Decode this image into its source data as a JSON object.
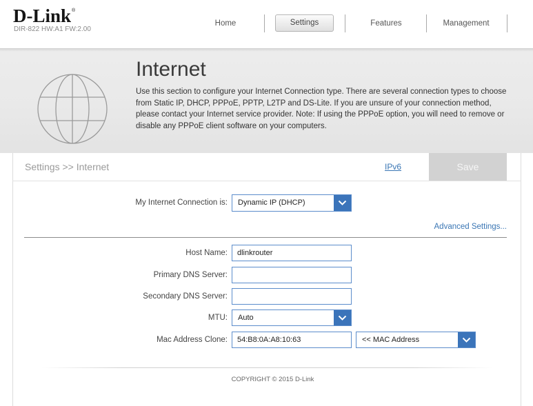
{
  "header": {
    "logo_text": "D-Link",
    "logo_mark": "®",
    "model_info": "DIR-822 HW:A1 FW:2.00",
    "nav": [
      {
        "label": "Home",
        "active": false
      },
      {
        "label": "Settings",
        "active": true
      },
      {
        "label": "Features",
        "active": false
      },
      {
        "label": "Management",
        "active": false
      }
    ]
  },
  "banner": {
    "icon": "globe-icon",
    "title": "Internet",
    "description_lines": [
      "Use this section to configure your Internet Connection type. There are several connection types to choose",
      "from Static IP, DHCP, PPPoE, PPTP, L2TP and DS-Lite. If you are unsure of your connection method,",
      "please contact your Internet service provider. Note: If using the PPPoE option, you will need to remove or",
      "disable any PPPoE client software on your computers."
    ]
  },
  "toolbar": {
    "breadcrumb": "Settings >> Internet",
    "ipv6_link": "IPv6",
    "save_label": "Save"
  },
  "form": {
    "connection_type": {
      "label": "My Internet Connection is:",
      "value": "Dynamic IP (DHCP)"
    },
    "advanced_link": "Advanced Settings...",
    "host_name": {
      "label": "Host Name:",
      "value": "dlinkrouter"
    },
    "primary_dns": {
      "label": "Primary DNS Server:",
      "value": ""
    },
    "secondary_dns": {
      "label": "Secondary DNS Server:",
      "value": ""
    },
    "mtu": {
      "label": "MTU:",
      "value": "Auto"
    },
    "mac_clone": {
      "label": "Mac Address Clone:",
      "value": "54:B8:0A:A8:10:63",
      "source_select": "<< MAC Address"
    }
  },
  "footer": {
    "copyright": "COPYRIGHT © 2015 D-Link"
  },
  "theme": {
    "accent": "#3b74ba",
    "input_border": "#5b8ccb",
    "link": "#3a76b4",
    "save_bg": "#d2d2d2"
  }
}
